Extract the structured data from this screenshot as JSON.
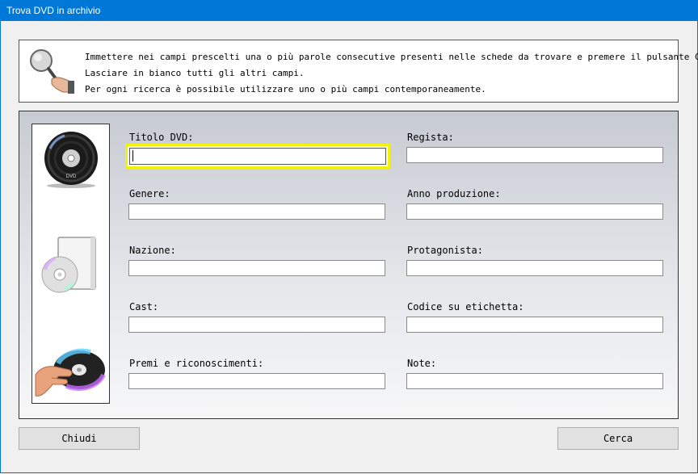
{
  "window": {
    "title": "Trova DVD in archivio"
  },
  "info": {
    "lines": [
      "Immettere nei campi prescelti una o più parole consecutive presenti nelle schede da trovare e premere il pulsante Cerca.",
      "Lasciare in bianco tutti gli altri campi.",
      "Per ogni ricerca è possibile utilizzare uno o più campi contemporaneamente."
    ]
  },
  "fields": {
    "titolo": {
      "label": "Titolo DVD:",
      "value": ""
    },
    "regista": {
      "label": "Regista:",
      "value": ""
    },
    "genere": {
      "label": "Genere:",
      "value": ""
    },
    "anno": {
      "label": "Anno produzione:",
      "value": ""
    },
    "nazione": {
      "label": "Nazione:",
      "value": ""
    },
    "protagonista": {
      "label": "Protagonista:",
      "value": ""
    },
    "cast": {
      "label": "Cast:",
      "value": ""
    },
    "codice": {
      "label": "Codice su etichetta:",
      "value": ""
    },
    "premi": {
      "label": "Premi e riconoscimenti:",
      "value": ""
    },
    "note": {
      "label": "Note:",
      "value": ""
    }
  },
  "buttons": {
    "close": "Chiudi",
    "search": "Cerca"
  },
  "images": {
    "dvd_disc_label": "DVD",
    "icons": [
      "magnifier-icon",
      "dvd-disc-icon",
      "dvd-case-icon",
      "hand-disc-icon"
    ]
  },
  "colors": {
    "titlebar": "#0078d7",
    "focus": "#f1f10d"
  }
}
